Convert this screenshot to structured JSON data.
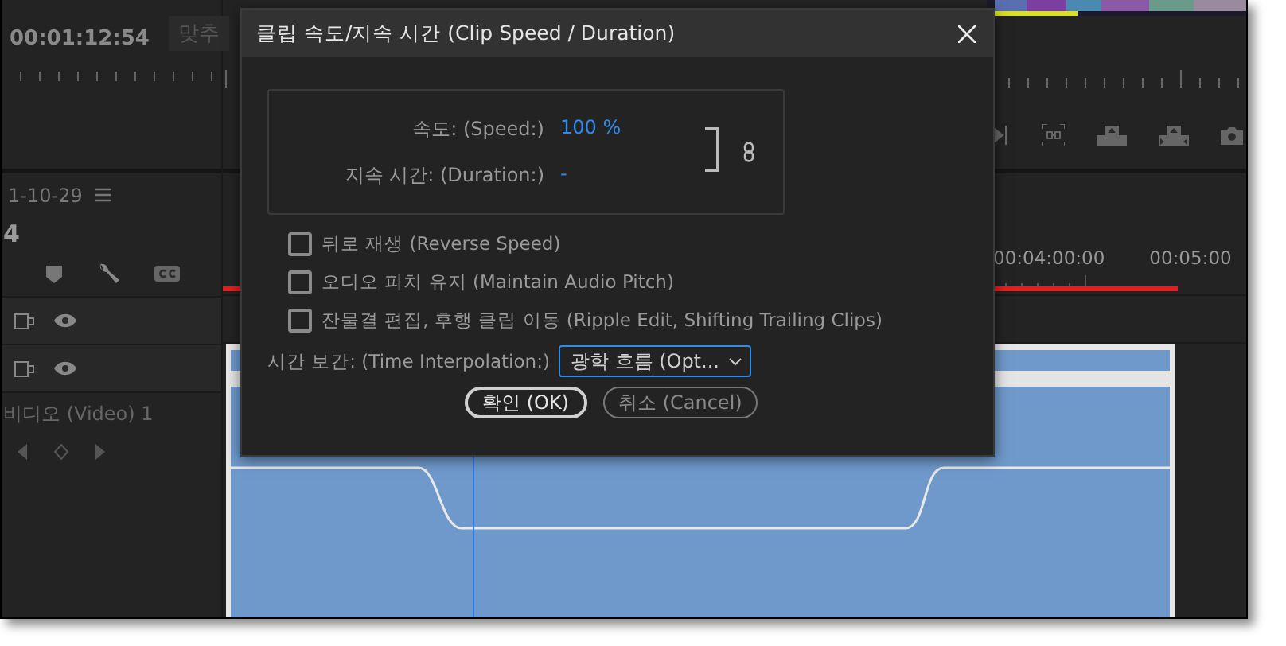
{
  "background": {
    "timecode": "00:01:12:54",
    "fit_button": "맞추",
    "date": "1-10-29",
    "sequence": "4",
    "ruler_labels": [
      "00:04:00:00",
      "00:05:00"
    ],
    "video_track": "비디오 (Video) 1"
  },
  "dialog": {
    "title": "클립 속도/지속 시간 (Clip Speed / Duration)",
    "speed_label": "속도: (Speed:)",
    "speed_value": "100",
    "speed_unit": "%",
    "duration_label": "지속 시간: (Duration:)",
    "duration_value": "-",
    "checkboxes": [
      {
        "label": "뒤로 재생 (Reverse Speed)",
        "checked": false
      },
      {
        "label": "오디오 피치 유지 (Maintain Audio Pitch)",
        "checked": false
      },
      {
        "label": "잔물결 편집, 후행 클립 이동 (Ripple Edit, Shifting Trailing Clips)",
        "checked": false
      }
    ],
    "interpolation": {
      "label": "시간 보간: (Time Interpolation:)",
      "value": "광학 흐름 (Opt..."
    },
    "buttons": [
      {
        "label": "확인 (OK)",
        "kind": "primary"
      },
      {
        "label": "취소 (Cancel)",
        "kind": "secondary"
      }
    ]
  }
}
